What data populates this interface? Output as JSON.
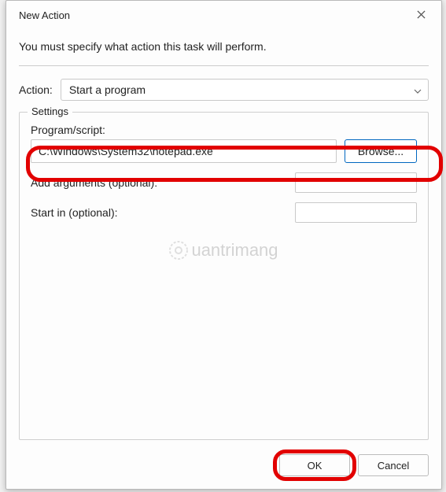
{
  "window": {
    "title": "New Action"
  },
  "instruction": "You must specify what action this task will perform.",
  "action": {
    "label": "Action:",
    "selected": "Start a program"
  },
  "settings": {
    "legend": "Settings",
    "program_label": "Program/script:",
    "program_value": "C:\\Windows\\System32\\notepad.exe",
    "browse_label": "Browse...",
    "args_label": "Add arguments (optional):",
    "args_value": "",
    "startin_label": "Start in (optional):",
    "startin_value": ""
  },
  "footer": {
    "ok": "OK",
    "cancel": "Cancel"
  },
  "watermark": "uantrimang"
}
